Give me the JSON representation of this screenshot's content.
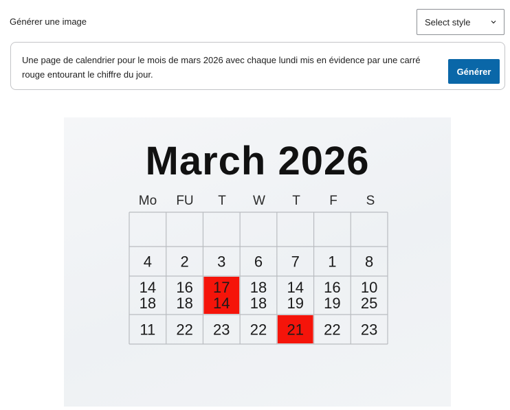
{
  "panel": {
    "title": "Générer une image",
    "style_select": {
      "selected": "Select style"
    },
    "prompt": "Une page de calendrier pour le mois de mars 2026 avec chaque lundi mis en évidence par une carré rouge entourant le chiffre du jour.",
    "generate_label": "Générer"
  },
  "calendar_image": {
    "title": "March 2026",
    "day_headers": [
      "Mo",
      "FU",
      "T",
      "W",
      "T",
      "F",
      "S"
    ],
    "rows": [
      [
        [],
        [],
        [],
        [],
        [],
        [],
        []
      ],
      [
        [
          "4"
        ],
        [
          "2"
        ],
        [
          "3"
        ],
        [
          "6"
        ],
        [
          "7"
        ],
        [
          "1"
        ],
        [
          "8"
        ]
      ],
      [
        [
          "14",
          "18"
        ],
        [
          "16",
          "18"
        ],
        [
          "17",
          "14"
        ],
        [
          "18",
          "18"
        ],
        [
          "14",
          "19"
        ],
        [
          "16",
          "19"
        ],
        [
          "10",
          "25"
        ]
      ],
      [
        [
          "11"
        ],
        [
          "22"
        ],
        [
          "23"
        ],
        [
          "22"
        ],
        [
          "21"
        ],
        [
          "22"
        ],
        [
          "23"
        ]
      ]
    ],
    "highlighted_cells": [
      [
        2,
        2
      ],
      [
        3,
        4
      ]
    ],
    "highlight_color": "#f5140a"
  },
  "colors": {
    "accent": "#0a67a8",
    "border": "#c3c4c7"
  }
}
